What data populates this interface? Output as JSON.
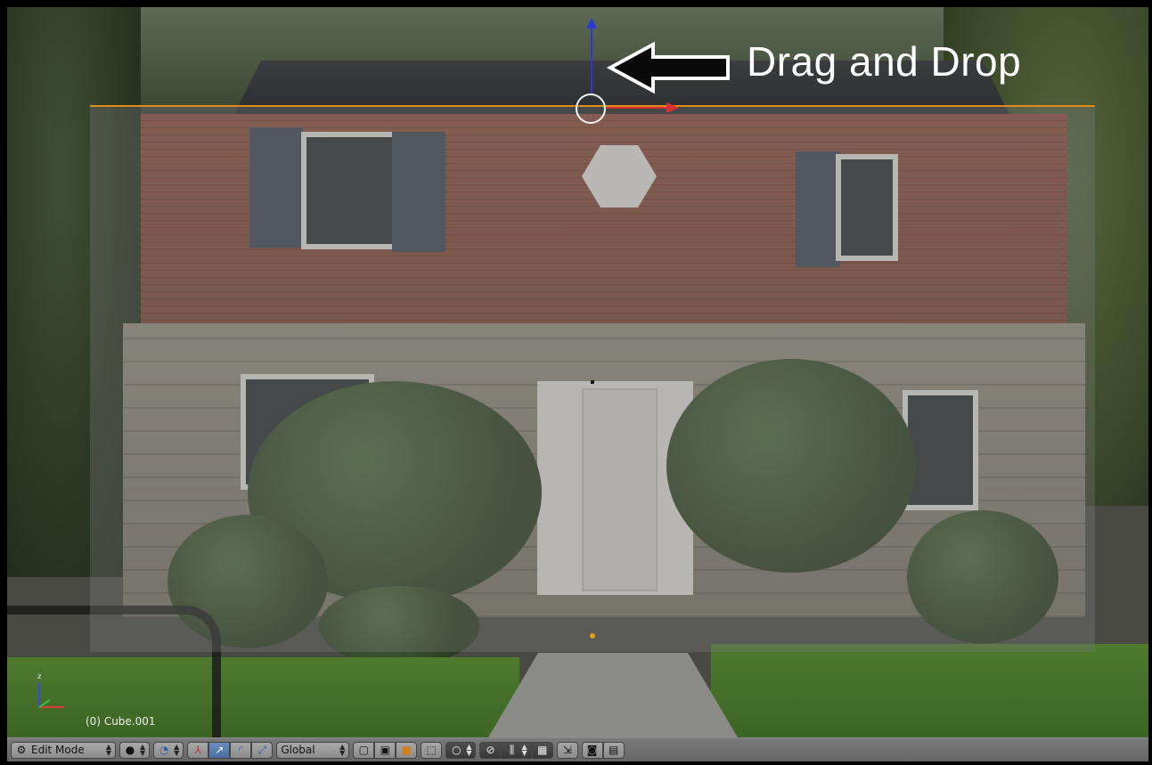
{
  "annotation": {
    "text": "Drag and Drop"
  },
  "viewport": {
    "object_label": "(0) Cube.001",
    "axes": {
      "z": "z",
      "x": "x",
      "y": "y"
    }
  },
  "header": {
    "mode_label": "Edit Mode",
    "orientation_label": "Global",
    "icons": [
      "editor-type-icon",
      "viewport-shading-icon",
      "pivot-point-icon",
      "manipulator-toggle-icon",
      "translate-icon",
      "rotate-icon",
      "scale-icon",
      "vertex-select-icon",
      "edge-select-icon",
      "face-select-icon",
      "limit-selection-icon",
      "proportional-edit-icon",
      "snap-icon",
      "snap-target-icon",
      "render-icon",
      "render-animation-icon"
    ]
  },
  "colors": {
    "selection_outline": "#e08a1a",
    "z_axis": "#2a3ad0",
    "x_axis": "#d83030",
    "header_bg": "#6e6e6e"
  }
}
